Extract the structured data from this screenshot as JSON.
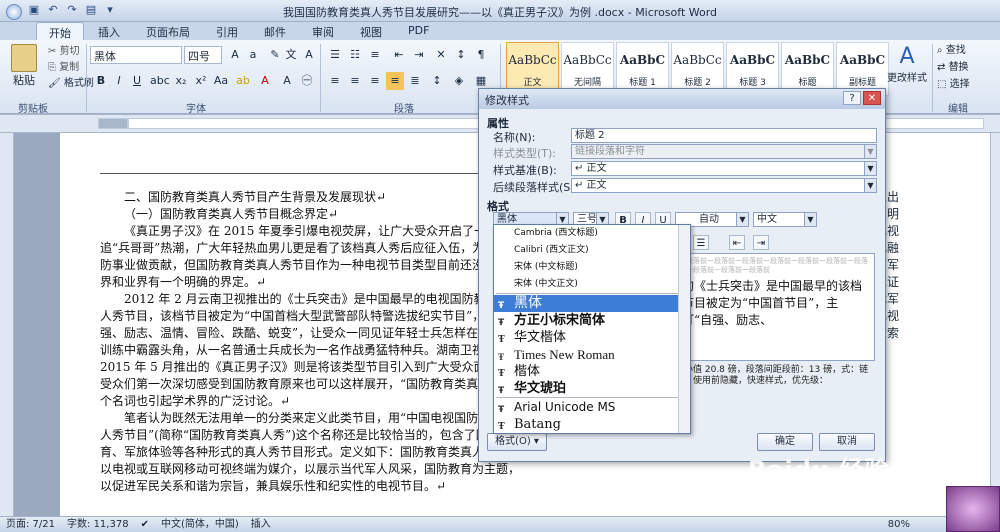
{
  "window": {
    "title": "我国国防教育类真人秀节目发展研究——以《真正男子汉》为例 .docx - Microsoft Word"
  },
  "ribbon": {
    "tabs": [
      "开始",
      "插入",
      "页面布局",
      "引用",
      "邮件",
      "审阅",
      "视图",
      "PDF"
    ],
    "clipboard": {
      "paste": "粘贴",
      "cut": "剪切",
      "copy": "复制",
      "format_painter": "格式刷",
      "group": "剪贴板"
    },
    "font": {
      "name": "黑体",
      "size": "四号",
      "group": "字体"
    },
    "paragraph_group": "段落",
    "styles": [
      {
        "sample": "AaBbCc",
        "name": "正文"
      },
      {
        "sample": "AaBbCc",
        "name": "无间隔"
      },
      {
        "sample": "AaBbC",
        "name": "标题 1"
      },
      {
        "sample": "AaBbCc",
        "name": "标题 2"
      },
      {
        "sample": "AaBbC",
        "name": "标题 3"
      },
      {
        "sample": "AaBbC",
        "name": "标题"
      },
      {
        "sample": "AaBbC",
        "name": "副标题"
      }
    ],
    "change_styles": "更改样式",
    "editing": {
      "find": "查找",
      "replace": "替换",
      "select": "选择",
      "group": "编辑"
    }
  },
  "document": {
    "paragraphs": [
      "二、国防教育类真人秀节目产生背景及发展现状↵",
      "（一）国防教育类真人秀节目概念界定↵",
      "《真正男子汉》在 2015 年夏季引爆电视荧屏，让广大受众开启了一波全民追“兵哥哥”热潮，广大年轻热血男儿更是看了该档真人秀后应征入伍，为祖国国防事业做贡献，但国防教育类真人秀节目作为一种电视节目类型目前还没有在学界和业界有一个明确的界定。↵",
      "2012 年 2 月云南卫视推出的《士兵突击》是中国最早的电视国防教育类真人秀节目，该档节目被定为“中国首档大型武警部队特警选拔纪实节目”，主打“自强、励志、温情、冒险、跌酷、蜕变”，让受众一同见证年轻士兵怎样在军事科目训练中霸露头角，从一名普通士兵成长为一名作战勇猛特种兵。湖南卫视于 2015 年 5 月推出的《真正男子汉》则是将该类型节目引入到广大受众面前，让受众们第一次深切感受到国防教育原来也可以这样展开，“国防教育类真人秀”这个名词也引起学术界的广泛讨论。↵",
      "笔者认为既然无法用单一的分类来定义此类节目，用“中国电视国防教育类真人秀节目”(简称“国防教育类真人秀”)这个名称还是比较恰当的，包含了国防教育、军旅体验等各种形式的真人秀节目形式。定义如下：国防教育类真人秀节目以电视或互联网移动可视终端为媒介，以展示当代军人风采，国防教育为主题，以促进军民关系和谐为宗旨，兼具娱乐性和纪实性的电视节目。↵"
    ],
    "right_column": [
      "推出",
      "立明",
      "电视",
      "化融",
      "则军",
      "见证",
      "战军",
      "己视",
      "家索"
    ]
  },
  "dialog": {
    "title": "修改样式",
    "section_properties": "属性",
    "name_label": "名称(N):",
    "name_value": "标题 2",
    "type_label": "样式类型(T):",
    "type_value": "链接段落和字符",
    "based_on_label": "样式基准(B):",
    "based_on_value": "↵ 正文",
    "following_label": "后续段落样式(S):",
    "following_value": "↵ 正文",
    "section_format": "格式",
    "font_value": "黑体",
    "size_value": "三号",
    "color_value": "自动",
    "lang_value": "中文",
    "bold": "B",
    "italic": "I",
    "underline": "U",
    "preview_text": "的《士兵突击》是中国最早的该档节目被定为“中国首节目”，主打“自强、励志、",
    "preview_ghost": "一段落前一段落前一段落前一段落前一段落前一段落前一段落前一段落前一段落前一段落前",
    "description": "最小值 20.8 磅，段落间距段前：13 磅，式：链接，使用前隐藏，快速样式，优先级：",
    "format_button": "格式(O) ▾",
    "ok": "确定",
    "cancel": "取消"
  },
  "font_dropdown": {
    "theme_fonts": [
      "Cambria (西文标题)",
      "Calibri (西文正文)",
      "宋体 (中文标题)",
      "宋体 (中文正文)"
    ],
    "fonts": [
      "黑体",
      "方正小标宋简体",
      "华文楷体",
      "Times New Roman",
      "楷体",
      "华文琥珀"
    ],
    "recent": [
      "Arial Unicode MS",
      "Batang"
    ],
    "selected": "黑体"
  },
  "statusbar": {
    "page": "页面: 7/21",
    "words": "字数: 11,378",
    "language": "中文(简体，中国)",
    "mode": "插入",
    "zoom": "80%"
  },
  "watermark": {
    "brand": "Baidu 经验",
    "url": "jingyan.baidu.com"
  }
}
